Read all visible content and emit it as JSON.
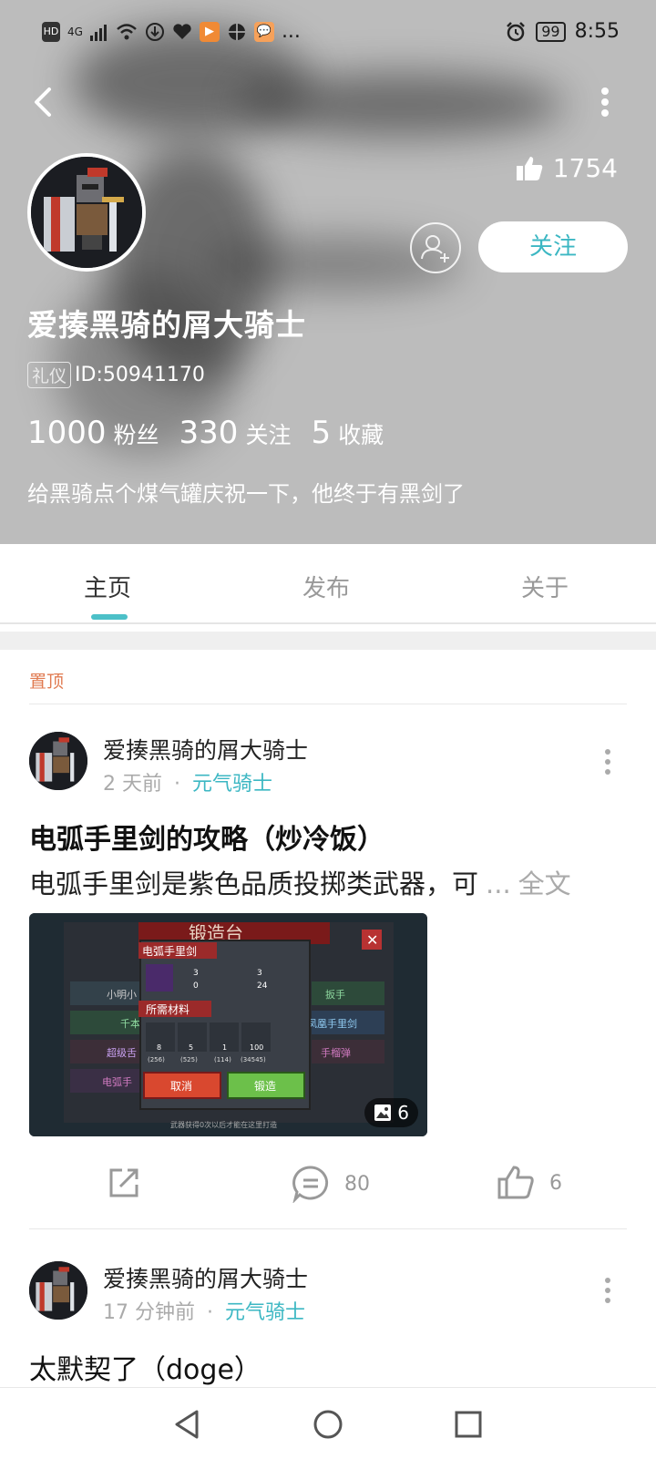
{
  "status_bar": {
    "left_icons": [
      "HD",
      "4G",
      "signal-icon",
      "wifi-icon",
      "download-icon",
      "heart-icon",
      "app-icon-orange",
      "gift-icon",
      "chat-icon-orange",
      "..."
    ],
    "battery": "99",
    "time": "8:55"
  },
  "profile": {
    "likes": "1754",
    "follow_label": "关注",
    "username": "爱揍黑骑的屑大骑士",
    "tag": "礼仪",
    "id_text": "ID:50941170",
    "stats": [
      {
        "num": "1000",
        "label": "粉丝"
      },
      {
        "num": "330",
        "label": "关注"
      },
      {
        "num": "5",
        "label": "收藏"
      }
    ],
    "bio": "给黑骑点个煤气罐庆祝一下，他终于有黑剑了"
  },
  "tabs": [
    "主页",
    "发布",
    "关于"
  ],
  "pinned_label": "置顶",
  "posts": [
    {
      "author": "爱揍黑骑的屑大骑士",
      "time": "2 天前",
      "separator": "·",
      "game": "元气骑士",
      "title": "电弧手里剑的攻略（炒冷饭）",
      "excerpt": "电弧手里剑是紫色品质投掷类武器，可",
      "ellipsis": "...",
      "full_text": "全文",
      "image_count": "6",
      "comments": "80",
      "likes": "6",
      "image": {
        "title": "锻造台",
        "weapon_name": "电弧手里剑",
        "materials_label": "所需材料",
        "stat_values": [
          "3",
          "3",
          "0",
          "24"
        ],
        "material_counts": [
          "8",
          "5",
          "1",
          "100"
        ],
        "material_stock": [
          "(256)",
          "(525)",
          "(114)",
          "(34545)"
        ],
        "cancel_label": "取消",
        "forge_label": "锻造",
        "list_items": [
          "小明小",
          "千本",
          "超级舌",
          "电弧手"
        ],
        "right_items": [
          "扳手",
          "凤凰手里剑",
          "手榴弹"
        ],
        "footer_text": "武器获得0次以后才能在这里打造"
      }
    },
    {
      "author": "爱揍黑骑的屑大骑士",
      "time": "17 分钟前",
      "separator": "·",
      "game": "元气骑士",
      "text": "太默契了（doge）"
    }
  ],
  "colors": {
    "accent": "#3cb7c3",
    "pinned": "#e07a50",
    "header_bg": "#bcbcbc"
  }
}
